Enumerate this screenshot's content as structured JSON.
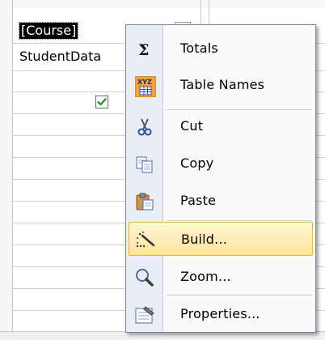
{
  "grid": {
    "field_cell": "[Course]",
    "table_cell": "StudentData",
    "show_checked": true
  },
  "context_menu": {
    "items": [
      {
        "label": "Totals",
        "icon": "sigma-icon"
      },
      {
        "label": "Table Names",
        "icon": "table-names-icon"
      },
      {
        "label": "Cut",
        "icon": "scissors-icon"
      },
      {
        "label": "Copy",
        "icon": "copy-icon"
      },
      {
        "label": "Paste",
        "icon": "paste-icon"
      },
      {
        "label": "Build...",
        "icon": "build-wand-icon",
        "highlighted": true
      },
      {
        "label": "Zoom...",
        "icon": "magnifier-icon"
      },
      {
        "label": "Properties...",
        "icon": "properties-icon"
      }
    ]
  },
  "colors": {
    "menu_background": "#fafafa",
    "menu_gutter": "#e9eef5",
    "highlight": "#ffe59a",
    "highlight_border": "#e3b44a"
  }
}
